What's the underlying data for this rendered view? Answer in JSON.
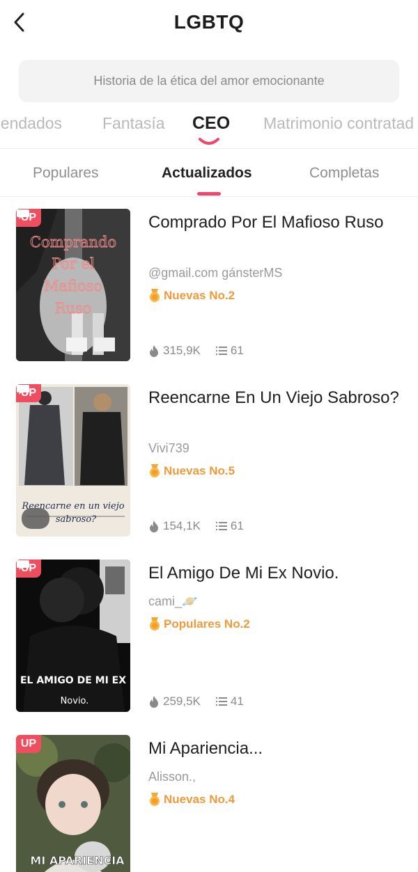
{
  "header": {
    "title": "LGBTQ"
  },
  "search": {
    "placeholder": "Historia de la ética del amor emocionante"
  },
  "category_tabs": [
    {
      "label": "nendados",
      "active": false
    },
    {
      "label": "Fantasía",
      "active": false
    },
    {
      "label": "CEO",
      "active": true
    },
    {
      "label": "Matrimonio contratad",
      "active": false
    }
  ],
  "sub_tabs": [
    {
      "label": "Populares",
      "active": false
    },
    {
      "label": "Actualizados",
      "active": true
    },
    {
      "label": "Completas",
      "active": false
    }
  ],
  "books": [
    {
      "title": "Comprado Por El Mafioso Ruso",
      "author": "@gmail.com gánsterMS",
      "rank": "Nuevas No.2",
      "views": "315,9K",
      "chapters": "61",
      "badge": "UP",
      "cover_text": [
        "Comprando",
        "Por el",
        "Mafioso",
        "Ruso"
      ]
    },
    {
      "title": "Reencarne En Un Viejo Sabroso?",
      "author": "Vivi739",
      "rank": "Nuevas No.5",
      "views": "154,1K",
      "chapters": "61",
      "badge": "UP",
      "cover_text": [
        "Reencarne en un viejo",
        "sabroso?"
      ]
    },
    {
      "title": "El Amigo De Mi Ex Novio.",
      "author": "cami_🪐",
      "rank": "Populares No.2",
      "views": "259,5K",
      "chapters": "41",
      "badge": "UP",
      "cover_text": [
        "EL AMIGO DE MI EX",
        "Novio."
      ]
    },
    {
      "title": "Mi Apariencia...",
      "author": "Alisson.,",
      "rank": "Nuevas No.4",
      "badge": "UP",
      "cover_text": [
        "MI APARIENCIA"
      ]
    }
  ],
  "colors": {
    "accent": "#f0466e",
    "rank": "#ef9a3a",
    "badge": "#f04e5e"
  }
}
